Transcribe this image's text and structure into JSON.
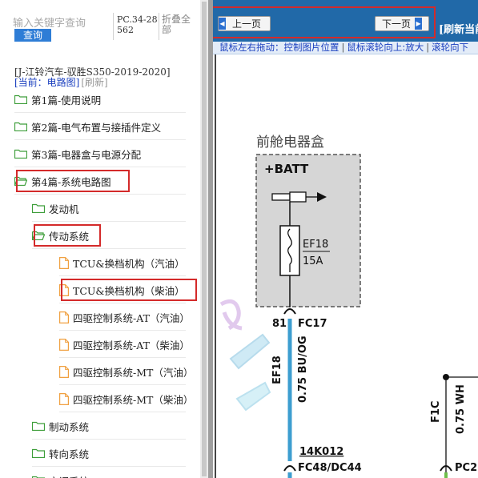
{
  "search": {
    "placeholder": "输入关键字查询",
    "button_label": "查询",
    "pc_code": "PC.34-28562",
    "collapse_label": "折叠全部"
  },
  "sidebar": {
    "vehicle_title": "[J-江铃汽车-驭胜S350-2019-2020]",
    "current_label": "[当前：电路图]",
    "refresh_label": "[刷新]",
    "items": [
      {
        "label": "第1篇-使用说明",
        "type": "folder",
        "state": "closed",
        "highlighted": false
      },
      {
        "label": "第2篇-电气布置与接插件定义",
        "type": "folder",
        "state": "closed",
        "highlighted": false
      },
      {
        "label": "第3篇-电器盒与电源分配",
        "type": "folder",
        "state": "closed",
        "highlighted": false
      },
      {
        "label": "第4篇-系统电路图",
        "type": "folder",
        "state": "open",
        "highlighted": true
      },
      {
        "label": "发动机",
        "type": "folder",
        "state": "closed",
        "highlighted": false
      },
      {
        "label": "传动系统",
        "type": "folder",
        "state": "open",
        "highlighted": true
      },
      {
        "label": "TCU&换档机构（汽油）",
        "type": "file",
        "highlighted": false
      },
      {
        "label": "TCU&换档机构（柴油）",
        "type": "file",
        "highlighted": true
      },
      {
        "label": "四驱控制系统-AT（汽油）",
        "type": "file",
        "highlighted": false
      },
      {
        "label": "四驱控制系统-AT（柴油）",
        "type": "file",
        "highlighted": false
      },
      {
        "label": "四驱控制系统-MT（汽油）",
        "type": "file",
        "highlighted": false
      },
      {
        "label": "四驱控制系统-MT（柴油）",
        "type": "file",
        "highlighted": false
      },
      {
        "label": "制动系统",
        "type": "folder",
        "state": "closed",
        "highlighted": false
      },
      {
        "label": "转向系统",
        "type": "folder",
        "state": "closed",
        "highlighted": false
      },
      {
        "label": "空调系统",
        "type": "folder",
        "state": "closed",
        "highlighted": false
      }
    ]
  },
  "viewer": {
    "prev_label": "上一页",
    "next_label": "下一页",
    "refresh_current": "[刷新当前",
    "hint": {
      "drag": "鼠标左右拖动：控制图片位置",
      "wheel_up": "鼠标滚轮向上:放大",
      "wheel_down": "滚轮向下"
    }
  },
  "diagram": {
    "box_title": "前舱电器盒",
    "batt_label": "+BATT",
    "fuse_name": "EF18",
    "fuse_rating": "15A",
    "pin_left": "81",
    "connector_left": "FC17",
    "wire_side_label": "EF18",
    "wire_spec": "0.75 BU/OG",
    "splice_label": "14K012",
    "bottom_connector": "FC48/DC44",
    "right_side_label": "F1C",
    "right_wire_spec": "0.75 WH",
    "right_bottom_connector": "PC2"
  },
  "colors": {
    "toolbar": "#2169a8",
    "hint_text": "#1a3fbf",
    "highlight_box": "#d42a2a",
    "wire_blue": "#3d9ed0",
    "folder_green": "#3e9e3a",
    "file_orange": "#f0a040"
  }
}
